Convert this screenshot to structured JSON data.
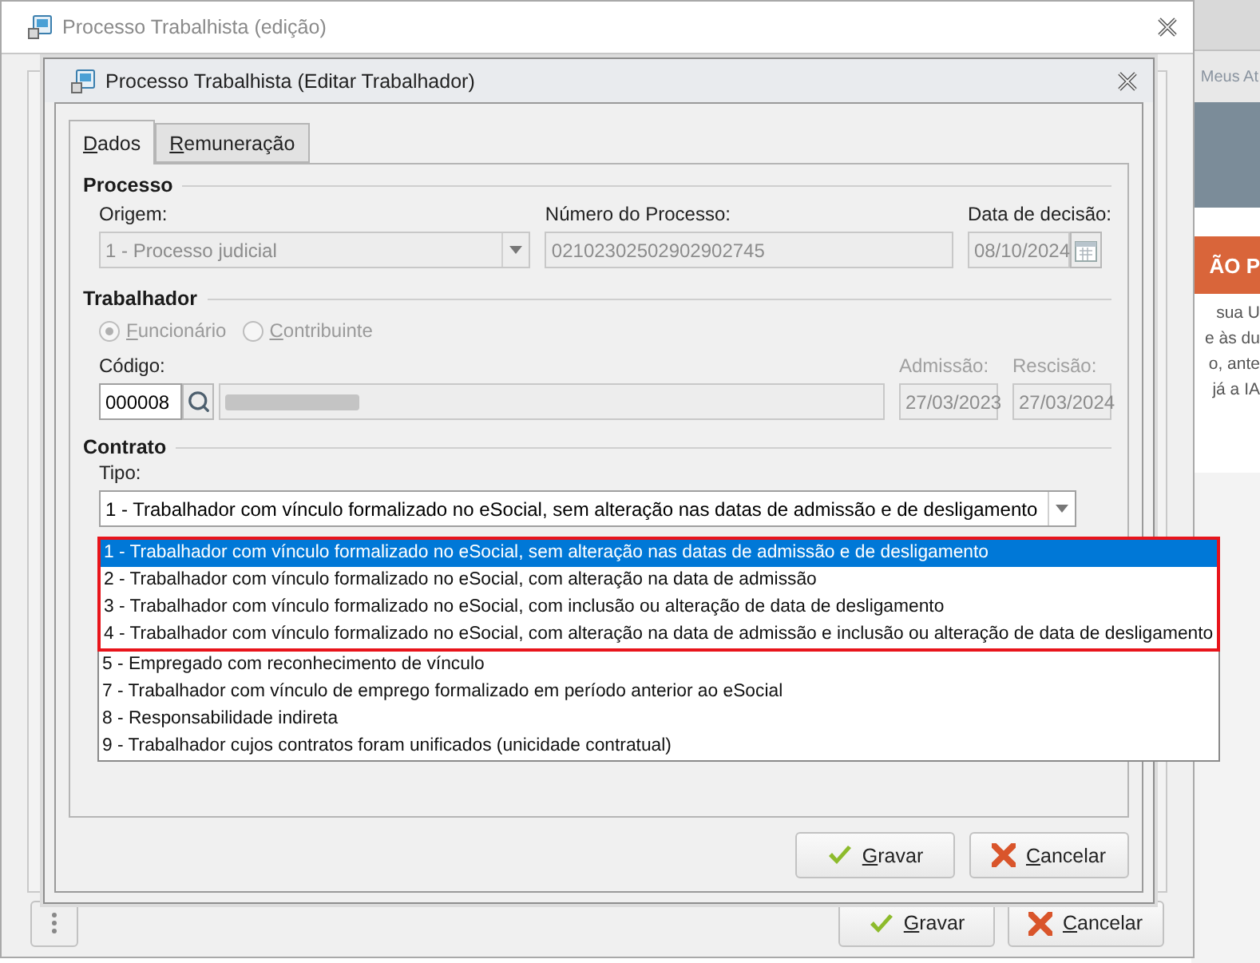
{
  "background_app": {
    "tab_label": "Meus At",
    "banner": "ÃO P",
    "text_lines": [
      "sua U",
      "e às du",
      "o, ante",
      "já a IA"
    ]
  },
  "outer_window": {
    "title": "Processo Trabalhista (edição)",
    "buttons": [
      {
        "label": "Gravar",
        "kind": "save"
      },
      {
        "label": "Cancelar",
        "kind": "cancel"
      }
    ]
  },
  "dialog": {
    "title": "Processo Trabalhista (Editar Trabalhador)",
    "tabs": [
      {
        "label": "Dados",
        "selected": true
      },
      {
        "label": "Remuneração",
        "selected": false
      }
    ],
    "processo": {
      "heading": "Processo",
      "origem": {
        "label": "Origem:",
        "value": "1 - Processo judicial",
        "disabled": true
      },
      "numero": {
        "label": "Número do Processo:",
        "value": "02102302502902902745",
        "disabled": true
      },
      "data_decisao": {
        "label": "Data de decisão:",
        "value": "08/10/2024",
        "disabled": true
      }
    },
    "trabalhador": {
      "heading": "Trabalhador",
      "radios": [
        {
          "label": "Funcionário",
          "selected": true,
          "disabled": true
        },
        {
          "label": "Contribuinte",
          "selected": false,
          "disabled": true
        }
      ],
      "codigo": {
        "label": "Código:",
        "value": "000008",
        "disabled": false
      },
      "admissao": {
        "label": "Admissão:",
        "value": "27/03/2023",
        "disabled": true
      },
      "rescisao": {
        "label": "Rescisão:",
        "value": "27/03/2024",
        "disabled": true
      }
    },
    "contrato": {
      "heading": "Contrato",
      "tipo": {
        "label": "Tipo:",
        "value": "1 - Trabalhador com vínculo formalizado no eSocial, sem alteração nas datas de admissão e de desligamento",
        "options": [
          {
            "label": "1 - Trabalhador com vínculo formalizado no eSocial, sem alteração nas datas de admissão e de desligamento",
            "selected": true,
            "highlighted": true
          },
          {
            "label": "2 - Trabalhador com vínculo formalizado no eSocial, com alteração na data de admissão",
            "selected": false,
            "highlighted": true
          },
          {
            "label": "3 - Trabalhador com vínculo formalizado no eSocial, com inclusão ou alteração de data de desligamento",
            "selected": false,
            "highlighted": true
          },
          {
            "label": "4 - Trabalhador com vínculo formalizado no eSocial, com alteração na data de admissão e inclusão ou alteração de data de desligamento",
            "selected": false,
            "highlighted": true
          },
          {
            "label": "5 - Empregado com reconhecimento de vínculo",
            "selected": false,
            "highlighted": false
          },
          {
            "label": "7 - Trabalhador com vínculo de emprego formalizado em período anterior ao eSocial",
            "selected": false,
            "highlighted": false
          },
          {
            "label": "8 - Responsabilidade indireta",
            "selected": false,
            "highlighted": false
          },
          {
            "label": "9 - Trabalhador cujos contratos foram unificados (unicidade contratual)",
            "selected": false,
            "highlighted": false
          }
        ]
      }
    },
    "buttons": [
      {
        "label": "Gravar",
        "kind": "save"
      },
      {
        "label": "Cancelar",
        "kind": "cancel"
      }
    ]
  }
}
